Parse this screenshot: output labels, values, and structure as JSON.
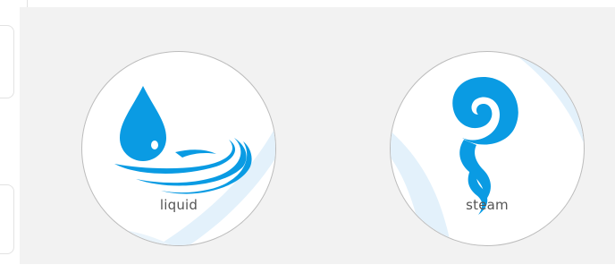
{
  "states": [
    {
      "id": "liquid",
      "label": "liquid",
      "icon": "water-drop-icon",
      "color": "#0a9be3"
    },
    {
      "id": "steam",
      "label": "steam",
      "icon": "steam-swirl-icon",
      "color": "#0a9be3"
    }
  ],
  "colors": {
    "panel": "#f2f2f2",
    "badge": "#ffffff",
    "swirl": "#e3f1fb",
    "label": "#555555"
  }
}
